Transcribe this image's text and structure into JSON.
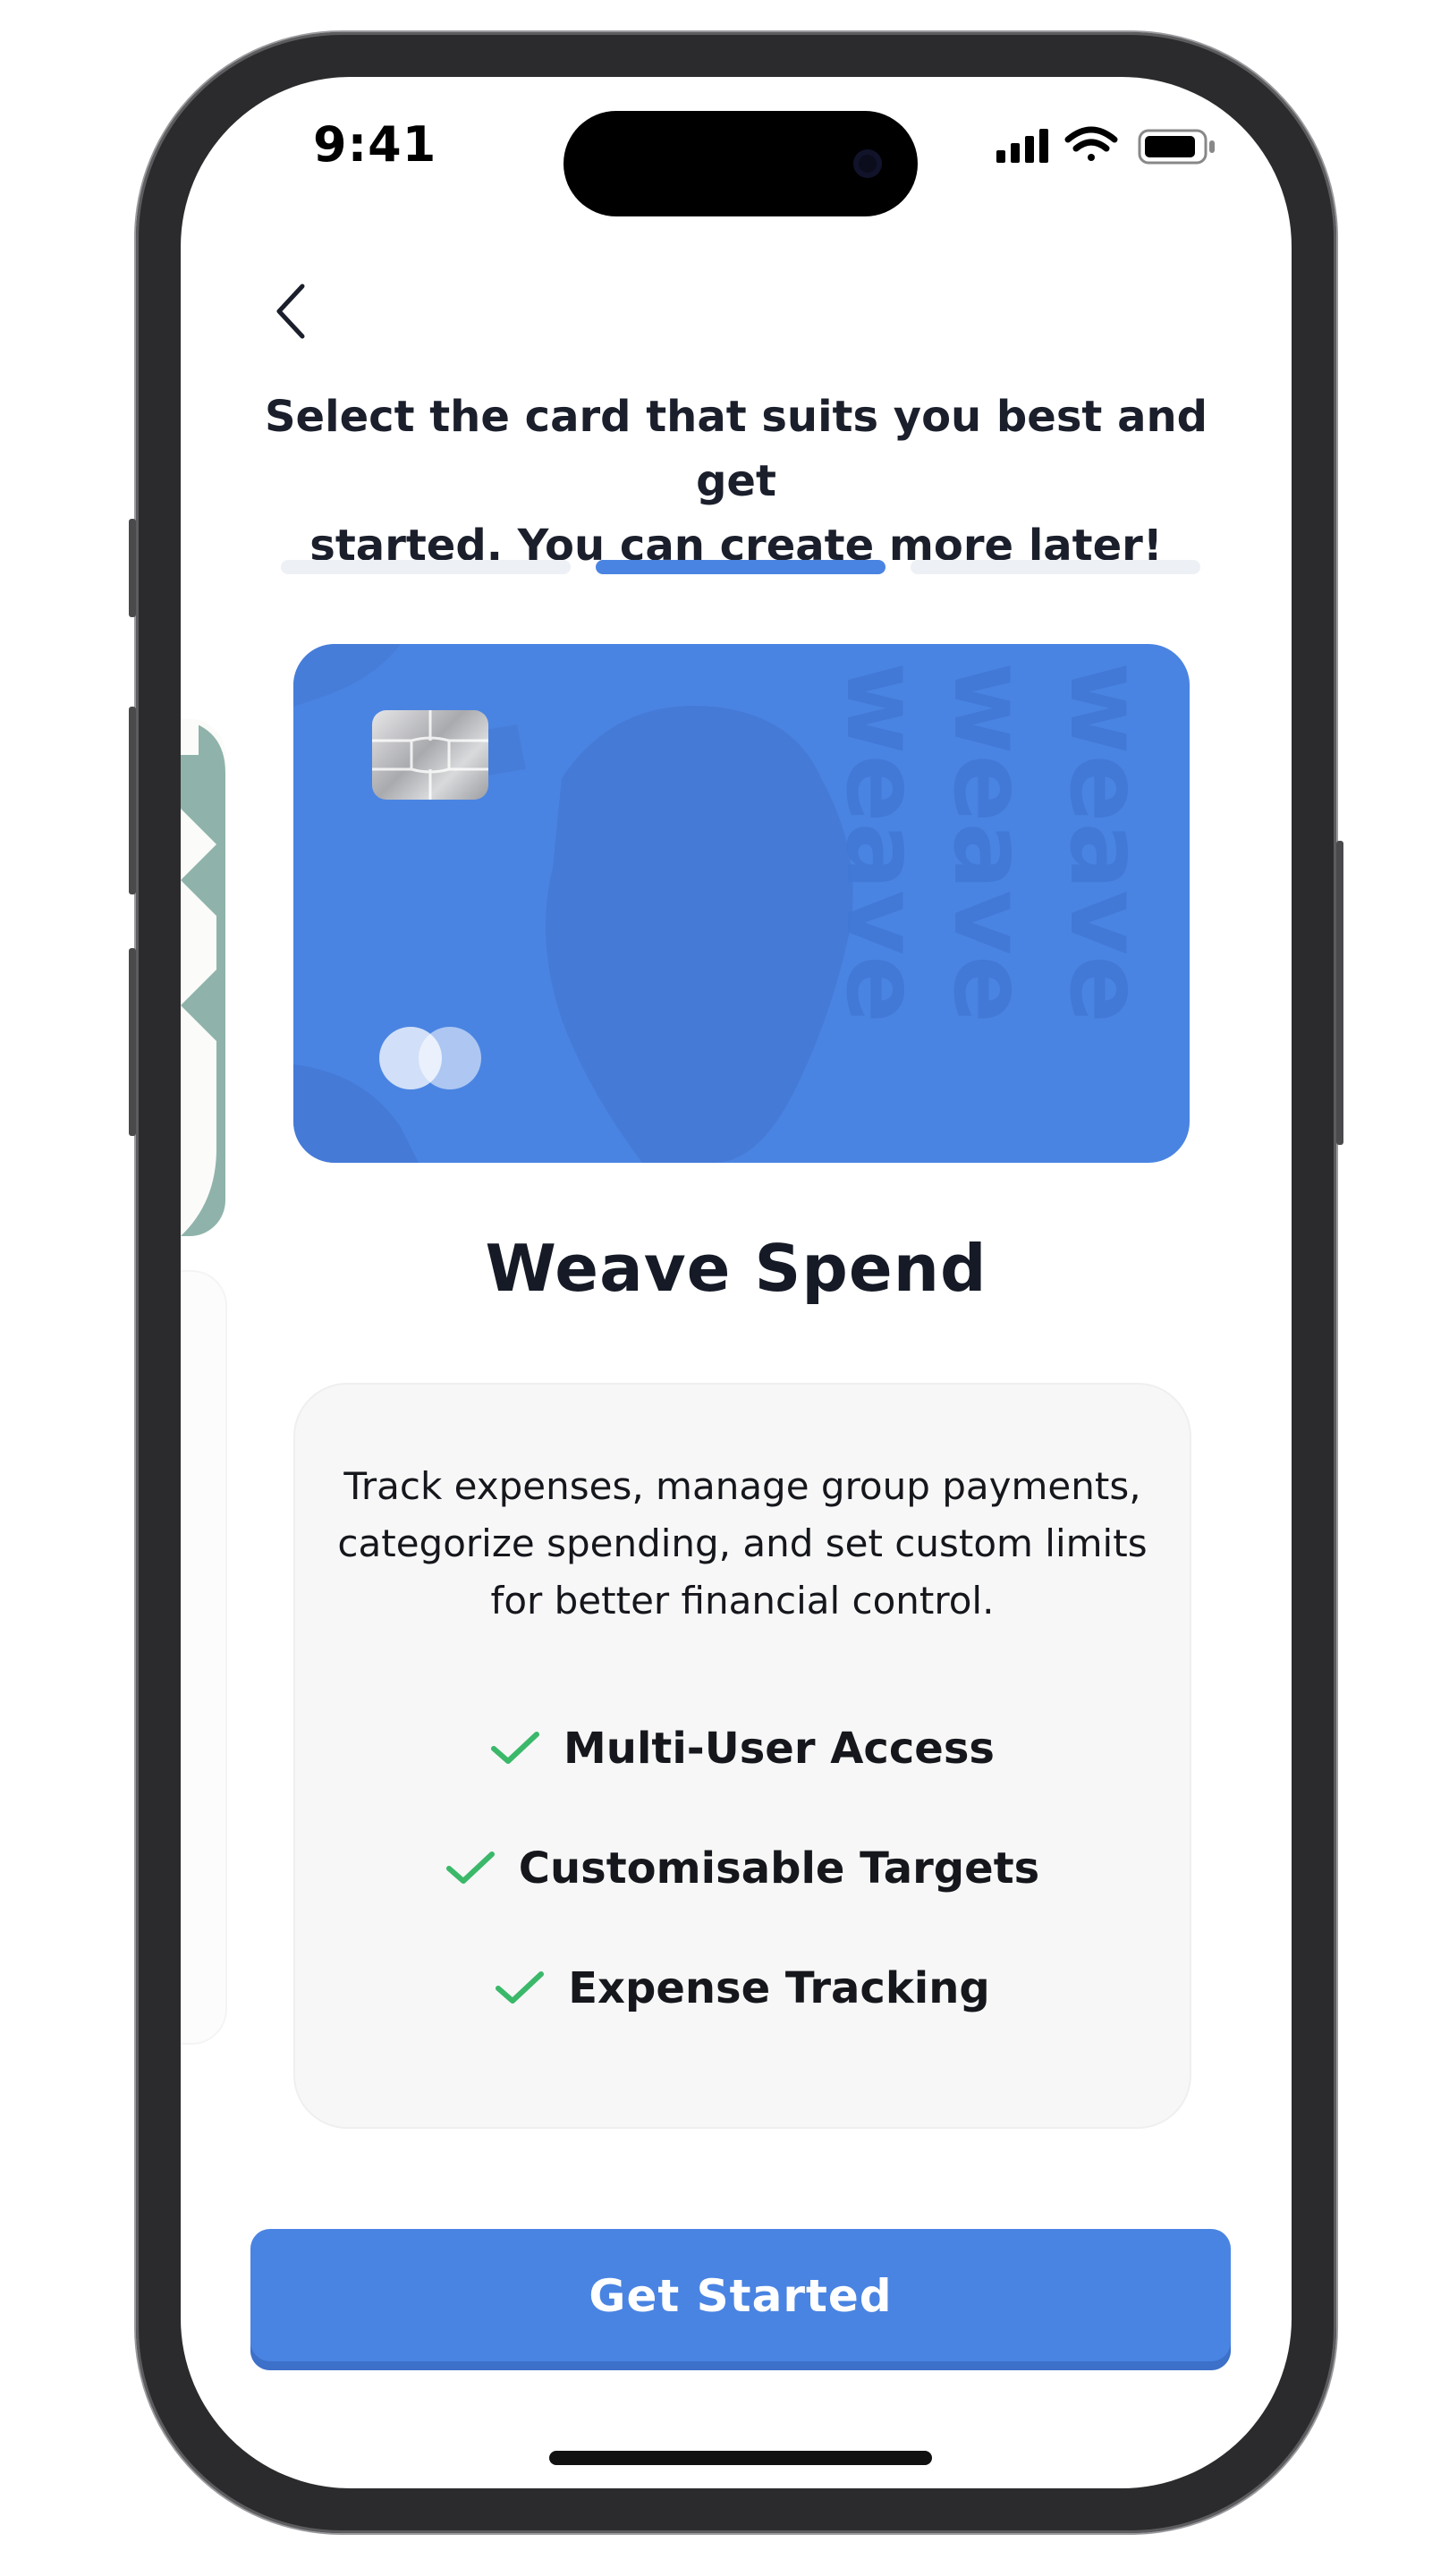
{
  "status_bar": {
    "time": "9:41"
  },
  "header": {
    "headline_line1": "Select the card that suits you best and get",
    "headline_line2": "started. You can create more later!"
  },
  "progress": {
    "steps": 3,
    "current_step": 2
  },
  "card": {
    "name": "Weave Spend",
    "color": "#4a84e2",
    "watermark": "weave"
  },
  "details": {
    "description_lines": [
      "Track expenses, manage group payments,",
      "categorize spending, and set custom limits",
      "for better financial control."
    ],
    "features": [
      {
        "label": "Multi-User Access",
        "icon": "check-icon"
      },
      {
        "label": "Customisable Targets",
        "icon": "check-icon"
      },
      {
        "label": "Expense Tracking",
        "icon": "check-icon"
      }
    ],
    "check_color": "#3bb86a"
  },
  "cta": {
    "label": "Get Started"
  },
  "colors": {
    "accent": "#4a84e2",
    "peek_card_green": "#8fb3aa"
  }
}
